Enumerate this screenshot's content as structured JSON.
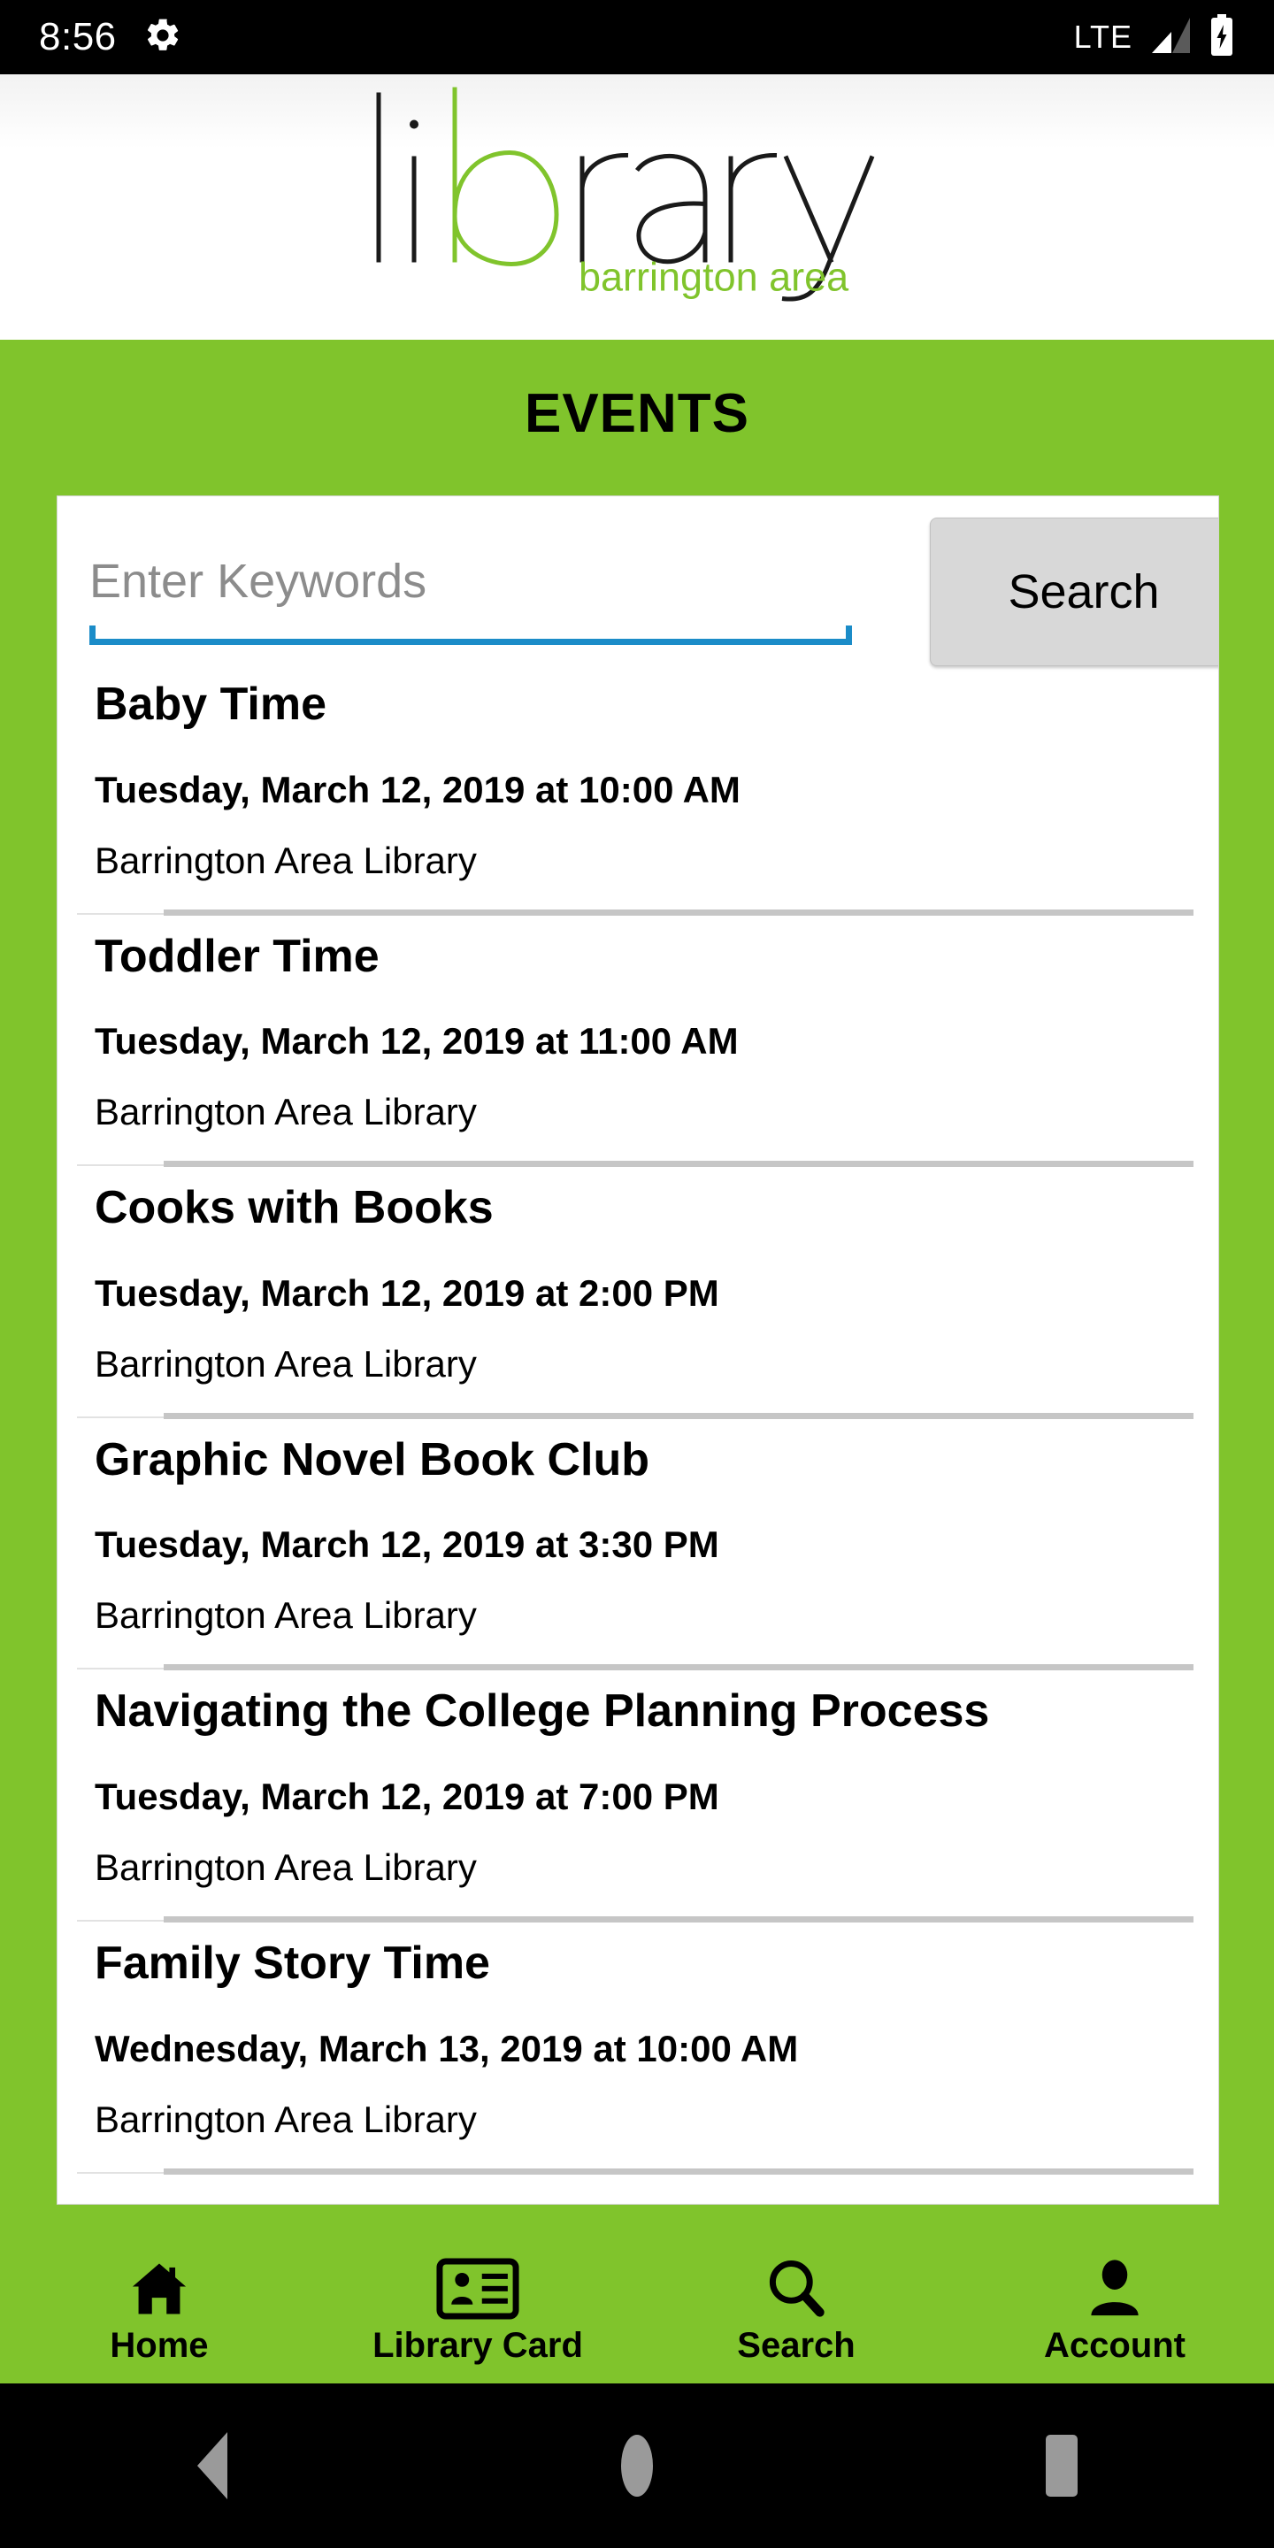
{
  "status_bar": {
    "clock": "8:56",
    "gear_icon": "gear-icon",
    "network_label": "LTE",
    "signal_icon": "signal-bars-icon",
    "battery_icon": "battery-charging-icon"
  },
  "logo": {
    "wordmark": "library",
    "tagline": "barrington area",
    "accent_color": "#80c42c"
  },
  "header": {
    "title": "EVENTS",
    "background_color": "#80c42c"
  },
  "search": {
    "placeholder": "Enter Keywords",
    "value": "",
    "button_label": "Search",
    "underline_color": "#1b8cc8"
  },
  "events": [
    {
      "title": "Baby Time",
      "datetime": "Tuesday, March 12, 2019 at 10:00 AM",
      "location": "Barrington Area Library"
    },
    {
      "title": "Toddler Time",
      "datetime": "Tuesday, March 12, 2019 at 11:00 AM",
      "location": "Barrington Area Library"
    },
    {
      "title": "Cooks with Books",
      "datetime": "Tuesday, March 12, 2019 at 2:00 PM",
      "location": "Barrington Area Library"
    },
    {
      "title": "Graphic Novel Book Club",
      "datetime": "Tuesday, March 12, 2019 at 3:30 PM",
      "location": "Barrington Area Library"
    },
    {
      "title": "Navigating the College Planning Process",
      "datetime": "Tuesday, March 12, 2019 at 7:00 PM",
      "location": "Barrington Area Library"
    },
    {
      "title": "Family Story Time",
      "datetime": "Wednesday, March 13, 2019 at 10:00 AM",
      "location": "Barrington Area Library"
    }
  ],
  "tabbar": {
    "items": [
      {
        "label": "Home",
        "icon": "home-icon"
      },
      {
        "label": "Library Card",
        "icon": "library-card-icon"
      },
      {
        "label": "Search",
        "icon": "search-icon"
      },
      {
        "label": "Account",
        "icon": "account-person-icon"
      }
    ]
  },
  "system_nav": {
    "back": "back-triangle-icon",
    "home": "home-circle-icon",
    "recents": "recents-square-icon"
  }
}
